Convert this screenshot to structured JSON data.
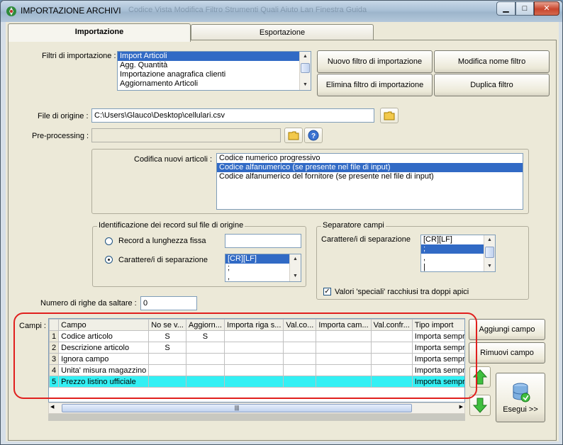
{
  "window": {
    "title": "IMPORTAZIONE ARCHIVI",
    "background_menu_ghost": "Codice   Vista   Modifica   Filtro   Strumenti   Quali   Aiuto   Lan   Finestra   Guida"
  },
  "tabs": [
    {
      "label": "Importazione",
      "active": true
    },
    {
      "label": "Esportazione",
      "active": false
    }
  ],
  "filters": {
    "label": "Filtri di importazione :",
    "items": [
      "Import Articoli",
      "Agg. Quantità",
      "Importazione anagrafica clienti",
      "Aggiornamento Articoli"
    ],
    "selected_index": 0
  },
  "buttons": {
    "new_filter": "Nuovo filtro di importazione",
    "rename_filter": "Modifica nome filtro",
    "delete_filter": "Elimina filtro di importazione",
    "duplicate_filter": "Duplica filtro",
    "add_field": "Aggiungi campo",
    "remove_field": "Rimuovi campo",
    "run": "Esegui >>"
  },
  "source_file": {
    "label": "File di origine :",
    "value": "C:\\Users\\Glauco\\Desktop\\cellulari.csv"
  },
  "preprocessing": {
    "label": "Pre-processing :",
    "value": ""
  },
  "encoding": {
    "label": "Codifica nuovi articoli :",
    "items": [
      "Codice numerico progressivo",
      "Codice alfanumerico (se presente nel file di input)",
      "Codice alfanumerico del fornitore (se presente nel file di input)"
    ],
    "selected_index": 1
  },
  "record_id": {
    "title": "Identificazione dei record sul file di origine",
    "option_fixed": "Record a lunghezza fissa",
    "option_separator": "Carattere/i di separazione",
    "fixed_value": "",
    "separator_items": [
      "[CR][LF]",
      ";",
      ","
    ]
  },
  "field_separator": {
    "title": "Separatore campi",
    "label": "Carattere/i di separazione",
    "items": [
      "[CR][LF]",
      ";",
      ",",
      "|"
    ],
    "selected_index": 1,
    "special_values_label": "Valori 'speciali' racchiusi tra doppi apici",
    "special_values_checked": true
  },
  "skip_rows": {
    "label": "Numero di righe da saltare  :",
    "value": "0"
  },
  "fields": {
    "label": "Campi :",
    "columns": [
      "Campo",
      "No se v...",
      "Aggiorn...",
      "Importa riga s...",
      "Val.co...",
      "Importa cam...",
      "Val.confr...",
      "Tipo import"
    ],
    "rows": [
      {
        "n": "1",
        "campo": "Codice articolo",
        "nosev": "S",
        "aggiorn": "S",
        "importa_riga": "",
        "valco": "",
        "importa_cam": "",
        "valconfr": "",
        "tipo": "Importa sempre"
      },
      {
        "n": "2",
        "campo": "Descrizione articolo",
        "nosev": "S",
        "aggiorn": "",
        "importa_riga": "",
        "valco": "",
        "importa_cam": "",
        "valconfr": "",
        "tipo": "Importa sempre"
      },
      {
        "n": "3",
        "campo": "Ignora campo",
        "nosev": "",
        "aggiorn": "",
        "importa_riga": "",
        "valco": "",
        "importa_cam": "",
        "valconfr": "",
        "tipo": "Importa sempre"
      },
      {
        "n": "4",
        "campo": "Unita' misura magazzino",
        "nosev": "",
        "aggiorn": "",
        "importa_riga": "",
        "valco": "",
        "importa_cam": "",
        "valconfr": "",
        "tipo": "Importa sempre"
      },
      {
        "n": "5",
        "campo": "Prezzo listino ufficiale",
        "nosev": "",
        "aggiorn": "",
        "importa_riga": "",
        "valco": "",
        "importa_cam": "",
        "valconfr": "",
        "tipo": "Importa sempre"
      }
    ],
    "highlighted_row": 4
  },
  "colors": {
    "selection": "#316ac5",
    "row_highlight": "#33f0f4",
    "annotation_red": "#e0201e"
  },
  "icons": [
    "app-icon",
    "minimize-icon",
    "maximize-icon",
    "close-icon",
    "folder-icon",
    "help-icon",
    "arrow-up-icon",
    "arrow-down-icon",
    "database-run-icon"
  ]
}
